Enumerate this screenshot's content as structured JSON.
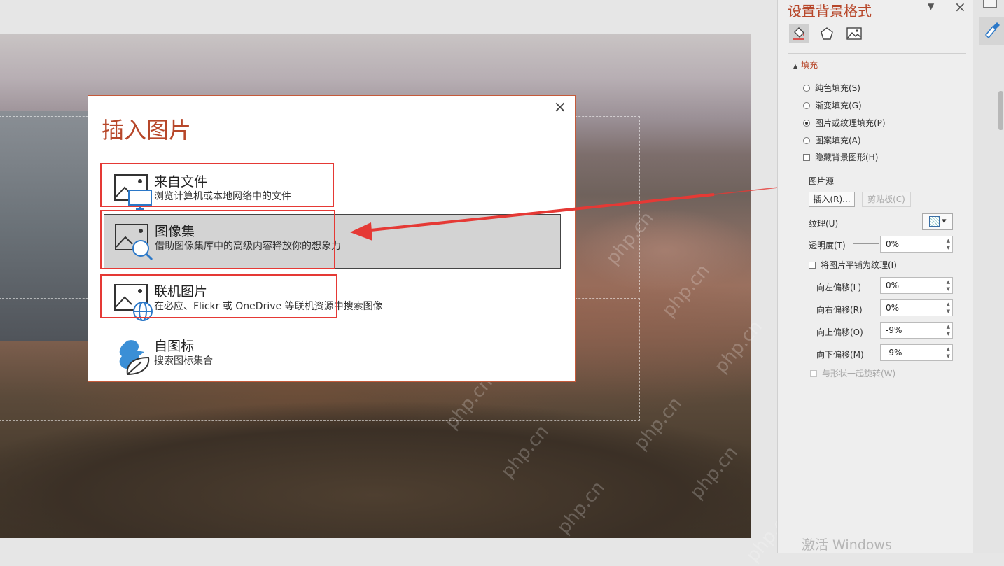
{
  "dialog": {
    "title": "插入图片",
    "close": "×",
    "options": [
      {
        "title": "来自文件",
        "desc": "浏览计算机或本地网络中的文件",
        "icon": "image-monitor-icon"
      },
      {
        "title": "图像集",
        "desc": "借助图像集库中的高级内容释放你的想象力",
        "icon": "image-search-icon",
        "selected": true
      },
      {
        "title": "联机图片",
        "desc": "在必应、Flickr 或 OneDrive 等联机资源中搜索图像",
        "icon": "image-globe-icon"
      },
      {
        "title": "自图标",
        "desc": "搜索图标集合",
        "icon": "bird-leaf-icon"
      }
    ]
  },
  "pane": {
    "title": "设置背景格式",
    "pin": "▼",
    "close": "×",
    "tabs": [
      "fill-bucket-icon",
      "pentagon-icon",
      "picture-icon"
    ],
    "section": "填充",
    "fill_options": [
      {
        "label": "纯色填充(S)",
        "selected": false
      },
      {
        "label": "渐变填充(G)",
        "selected": false
      },
      {
        "label": "图片或纹理填充(P)",
        "selected": true
      },
      {
        "label": "图案填充(A)",
        "selected": false
      }
    ],
    "hide_bg": "隐藏背景图形(H)",
    "pic_source": "图片源",
    "insert_btn": "插入(R)...",
    "clipboard_btn": "剪贴板(C)",
    "texture": "纹理(U)",
    "transparency": "透明度(T)",
    "transparency_value": "0%",
    "tile": "将图片平铺为纹理(I)",
    "offsets": [
      {
        "label": "向左偏移(L)",
        "value": "0%"
      },
      {
        "label": "向右偏移(R)",
        "value": "0%"
      },
      {
        "label": "向上偏移(O)",
        "value": "-9%"
      },
      {
        "label": "向下偏移(M)",
        "value": "-9%"
      }
    ],
    "rotate": "与形状一起旋转(W)",
    "activate": "激活 Windows"
  },
  "watermark": "php.cn",
  "colors": {
    "accent": "#b7472a",
    "annotation": "#e53935"
  }
}
